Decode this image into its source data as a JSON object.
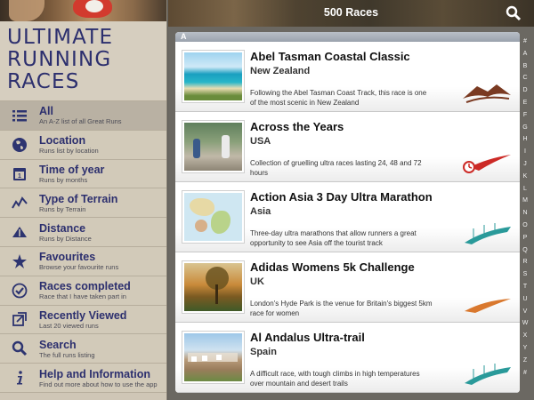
{
  "app": {
    "title_lines": [
      "ULTIMATE",
      "RUNNING",
      "RACES"
    ]
  },
  "topbar": {
    "title": "500 Races",
    "search_icon": "search-icon"
  },
  "menu": [
    {
      "label": "All",
      "sub": "An A-Z list of all Great Runs",
      "icon": "list-icon",
      "selected": true
    },
    {
      "label": "Location",
      "sub": "Runs list by location",
      "icon": "globe-icon",
      "selected": false
    },
    {
      "label": "Time of year",
      "sub": "Runs by months",
      "icon": "calendar-icon",
      "selected": false
    },
    {
      "label": "Type of Terrain",
      "sub": "Runs by Terrain",
      "icon": "terrain-icon",
      "selected": false
    },
    {
      "label": "Distance",
      "sub": "Runs by Distance",
      "icon": "distance-icon",
      "selected": false
    },
    {
      "label": "Favourites",
      "sub": "Browse your favourite runs",
      "icon": "star-icon",
      "selected": false
    },
    {
      "label": "Races completed",
      "sub": "Race that I have taken part in",
      "icon": "checkmark-icon",
      "selected": false
    },
    {
      "label": "Recently Viewed",
      "sub": "Last 20 viewed runs",
      "icon": "recent-icon",
      "selected": false
    },
    {
      "label": "Search",
      "sub": "The full runs listing",
      "icon": "search-icon",
      "selected": false
    },
    {
      "label": "Help and Information",
      "sub": "Find out more about how to use the app",
      "icon": "info-icon",
      "selected": false
    }
  ],
  "list": {
    "section": "A",
    "races": [
      {
        "name": "Abel Tasman Coastal Classic",
        "country": "New Zealand",
        "desc": "Following the Abel Tasman Coast Track, this race is one of the most scenic in New Zealand",
        "terrain_icon": "mountain-terrain-icon",
        "terrain_color": "#7a3a22"
      },
      {
        "name": "Across the Years",
        "country": "USA",
        "desc": "Collection of gruelling ultra races lasting 24, 48 and 72 hours",
        "terrain_icon": "timed-race-icon",
        "terrain_color": "#cc2a26"
      },
      {
        "name": "Action Asia 3 Day Ultra Marathon",
        "country": "Asia",
        "desc": "Three-day ultra marathons that allow runners a great opportunity to see Asia off the tourist track",
        "terrain_icon": "multi-day-track-icon",
        "terrain_color": "#2a9a9a"
      },
      {
        "name": "Adidas Womens 5k Challenge",
        "country": "UK",
        "desc": "London's Hyde Park is the venue for Britain's biggest 5km race for women",
        "terrain_icon": "road-terrain-icon",
        "terrain_color": "#d9782e"
      },
      {
        "name": "Al Andalus Ultra-trail",
        "country": "Spain",
        "desc": "A difficult race, with tough climbs in high temperatures over mountain and desert trails",
        "terrain_icon": "multi-day-track-icon",
        "terrain_color": "#2a9a9a"
      }
    ]
  },
  "index_letters": [
    "#",
    "A",
    "B",
    "C",
    "D",
    "E",
    "F",
    "G",
    "H",
    "I",
    "J",
    "K",
    "L",
    "M",
    "N",
    "O",
    "P",
    "Q",
    "R",
    "S",
    "T",
    "U",
    "V",
    "W",
    "X",
    "Y",
    "Z",
    "#"
  ]
}
